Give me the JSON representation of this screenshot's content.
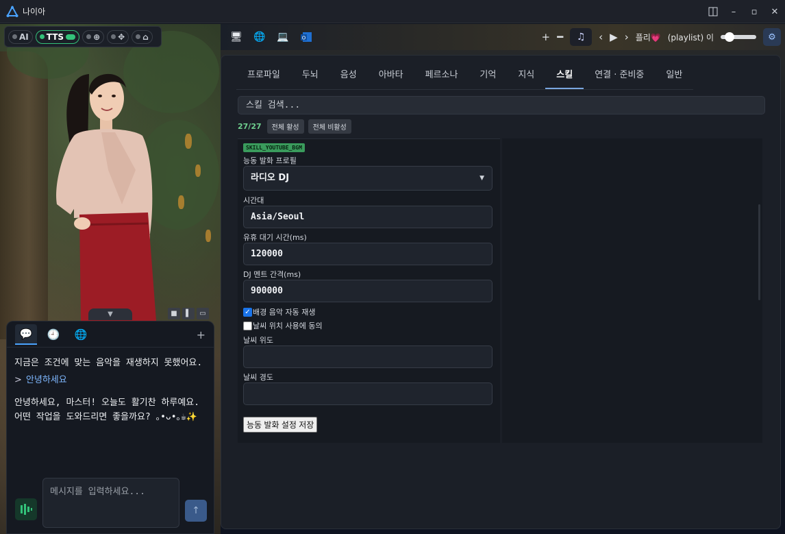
{
  "window": {
    "title": "나이아"
  },
  "toggles": {
    "ai": "AI",
    "tts": "TTS"
  },
  "topbar": {
    "player_track": "플리",
    "player_source": "(playlist) 이 ",
    "volume": 0.25
  },
  "tabs": [
    "프로파일",
    "두뇌",
    "음성",
    "아바타",
    "페르소나",
    "기억",
    "지식",
    "스킬",
    "연결 · 준비중",
    "일반"
  ],
  "active_tab": "스킬",
  "skills": {
    "search_placeholder": "스킬 검색...",
    "count": "27/27",
    "enable_all": "전체 활성",
    "disable_all": "전체 비활성"
  },
  "form": {
    "badge": "SKILL_YOUTUBE_BGM",
    "profile_label": "능동 발화 프로필",
    "profile_value": "라디오 DJ",
    "timezone_label": "시간대",
    "timezone_value": "Asia/Seoul",
    "idle_label": "유휴 대기 시간(ms)",
    "idle_value": "120000",
    "dj_label": "DJ 멘트 간격(ms)",
    "dj_value": "900000",
    "autoplay_label": "배경 음악 자동 재생",
    "autoplay_checked": true,
    "weather_consent_label": "날씨 위치 사용에 동의",
    "weather_consent_checked": false,
    "lat_label": "날씨 위도",
    "lat_value": "",
    "lon_label": "날씨 경도",
    "lon_value": "",
    "save_label": "능동 발화 설정 저장"
  },
  "chat": {
    "msg1": "지금은 조건에 맞는 음악을 재생하지 못했어요.",
    "quote_prefix": ">",
    "quote": "안녕하세요",
    "msg2": "안녕하세요, 마스터! 오늘도 활기찬 하루예요. 어떤 작업을 도와드리면 좋을까요? ｡•ᴗ•｡☕✨",
    "input_placeholder": "메시지를 입력하세요..."
  },
  "icons": {
    "app": "app-logo-icon",
    "gear": "gear-icon",
    "music": "music-note-icon"
  },
  "colors": {
    "accent": "#4aa3ff",
    "success": "#33c27a",
    "badge": "#3a9b5c"
  }
}
